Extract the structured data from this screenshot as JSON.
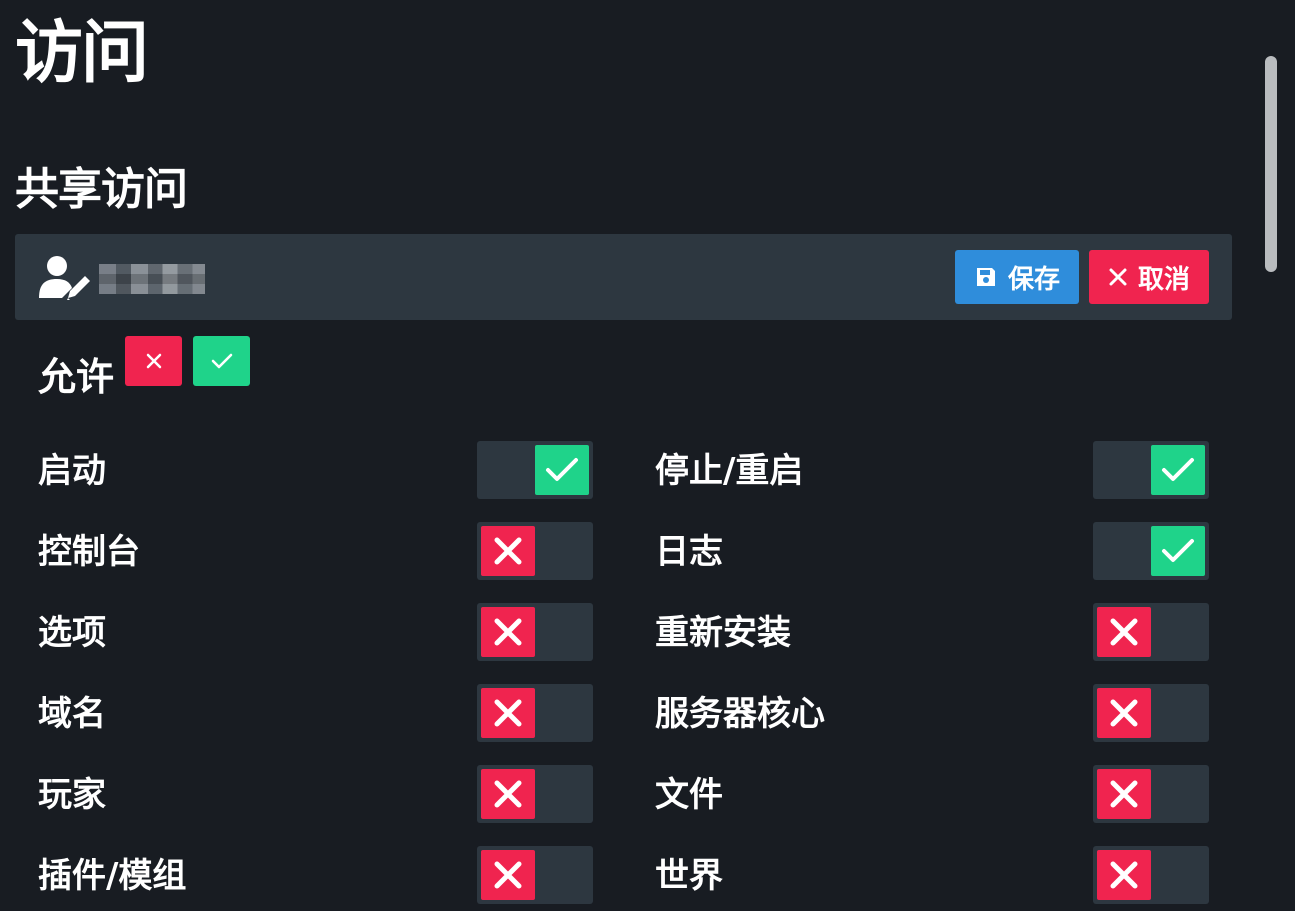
{
  "page": {
    "title": "访问"
  },
  "section": {
    "title": "共享访问"
  },
  "user_bar": {
    "icon": "user-edit-icon",
    "username": "",
    "save_label": "保存",
    "save_icon": "floppy-disk-icon",
    "cancel_label": "取消",
    "cancel_icon": "close-icon"
  },
  "allow": {
    "label": "允许",
    "deny_all_icon": "close-icon",
    "allow_all_icon": "check-icon"
  },
  "permissions": {
    "left": [
      {
        "label": "启动",
        "enabled": true
      },
      {
        "label": "控制台",
        "enabled": false
      },
      {
        "label": "选项",
        "enabled": false
      },
      {
        "label": "域名",
        "enabled": false
      },
      {
        "label": "玩家",
        "enabled": false
      },
      {
        "label": "插件/模组",
        "enabled": false
      }
    ],
    "right": [
      {
        "label": "停止/重启",
        "enabled": true
      },
      {
        "label": "日志",
        "enabled": true
      },
      {
        "label": "重新安装",
        "enabled": false
      },
      {
        "label": "服务器核心",
        "enabled": false
      },
      {
        "label": "文件",
        "enabled": false
      },
      {
        "label": "世界",
        "enabled": false
      }
    ]
  },
  "colors": {
    "background": "#181c22",
    "panel": "#2d3740",
    "primary": "#2f8ddb",
    "danger": "#f0244f",
    "success": "#1fd38a"
  }
}
